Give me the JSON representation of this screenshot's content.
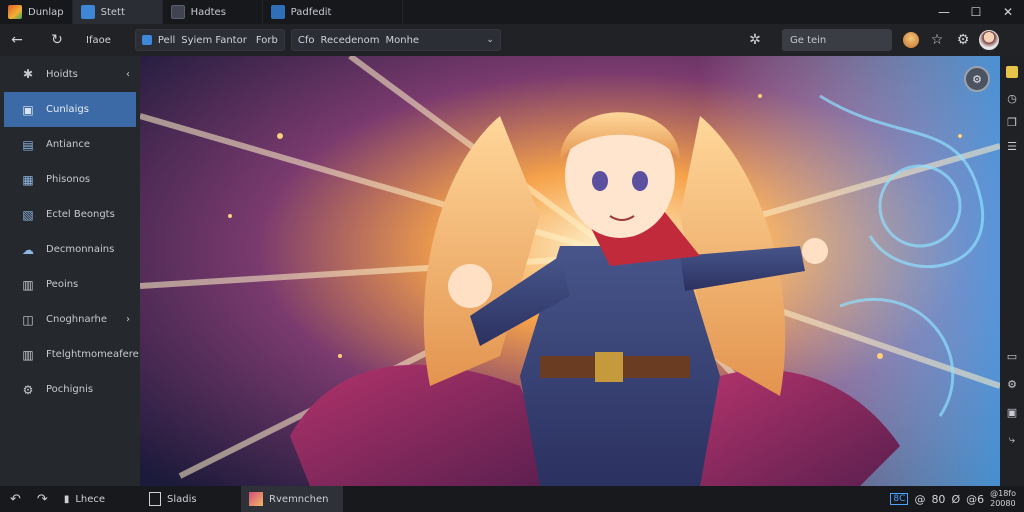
{
  "tabs": [
    {
      "label": "Dunlap",
      "icon": "app-logo-icon",
      "color": "#e05a2b"
    },
    {
      "label": "Stett",
      "icon": "window-icon",
      "color": "#3d87d6"
    },
    {
      "label": "Hadtes",
      "icon": "page-icon",
      "color": "#3f4450"
    },
    {
      "label": "Padfedit",
      "icon": "edit-icon",
      "color": "#2f6fb8"
    }
  ],
  "window": {
    "minimize": "—",
    "restore": "☐",
    "close": "✕"
  },
  "toolbar": {
    "back": "←",
    "reload": "↻",
    "home_label": "Ifaoe",
    "address_left": {
      "prefix": "Pell",
      "text": "Syiem Fantor",
      "suffix": "Forb"
    },
    "address_right": {
      "prefix": "Cfo",
      "text": "Recedenom",
      "suffix": "Monhe"
    },
    "search_placeholder": "Ge tein"
  },
  "sidebar": {
    "items": [
      {
        "label": "Hoidts",
        "icon": "star-icon",
        "caret": "‹"
      },
      {
        "label": "Cunlaigs",
        "icon": "folder-icon",
        "active": true
      },
      {
        "label": "Antiance",
        "icon": "folder-icon"
      },
      {
        "label": "Phisonos",
        "icon": "folder-icon"
      },
      {
        "label": "Ectel Beongts",
        "icon": "image-icon"
      },
      {
        "label": "Decmonnains",
        "icon": "cloud-icon"
      },
      {
        "label": "Peoins",
        "icon": "doc-icon"
      },
      {
        "label": "Cnoghnarhe",
        "icon": "folder-icon",
        "caret": "›"
      },
      {
        "label": "Ftelghtmomeafere",
        "icon": "doc-icon"
      },
      {
        "label": "Pochignis",
        "icon": "gear-icon"
      }
    ]
  },
  "bottombar": {
    "undo": "↶",
    "redo": "↷",
    "history_label": "Lhece",
    "task1_label": "Sladis",
    "task2_label": "Rvemnchen",
    "tray_badges": [
      "8C",
      "@",
      "80",
      "Ø",
      "@6"
    ],
    "tray_time": "@18fo",
    "tray_date": "20080"
  },
  "colors": {
    "accent": "#3b6aa6",
    "sidebar_bg": "#25282d",
    "titlebar_bg": "#16181c"
  }
}
